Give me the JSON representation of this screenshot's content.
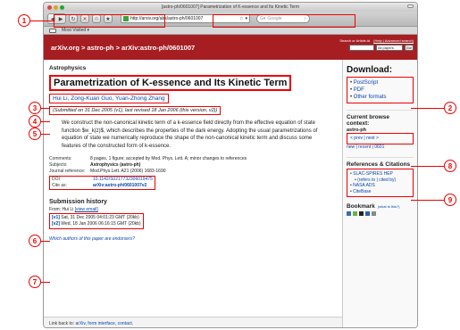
{
  "window": {
    "title": "[astro-ph/0601007] Parametrization of K-essence and Its Kinetic Term"
  },
  "toolbar": {
    "url": "http://arxiv.org/abs/astro-ph/0601007",
    "search_placeholder": "Google",
    "bookmark_label": "Most Visited ▾"
  },
  "header": {
    "breadcrumb": "arXiv.org > astro-ph > arXiv:astro-ph/0601007",
    "search_label": "Search or Article-id",
    "help_link": "(Help | Advanced search)",
    "search_scope": "All papers",
    "go_label": "Go!"
  },
  "paper": {
    "section": "Astrophysics",
    "title": "Parametrization of K-essence and Its Kinetic Term",
    "authors": "Hui Li, Zong-Kuan Guo, Yuan-Zhong Zhang",
    "submitted": "(Submitted on 31 Dec 2005 (v1), last revised 18 Jan 2006 (this version, v2))",
    "abstract": "We construct the non-canonical kinetic term of a k-essence field directly from the effective equation of state function $w_k(z)$, which describes the properties of the dark energy. Adopting the usual parametrizations of equation of state we numerically reproduce the shape of the non-canonical kinetic term and discuss some features of the constructed form of k-essence."
  },
  "meta": {
    "comments_key": "Comments:",
    "comments_val": "8 pages, 1 figure; accepted by Mod. Phys. Lett. A; minor changes to references",
    "subjects_key": "Subjects:",
    "subjects_val": "Astrophysics (astro-ph)",
    "journal_key": "Journal reference:",
    "journal_val": "Mod.Phys.Lett. A21 (2006) 1683-1690",
    "doi_key": "DOI",
    "doi_val": "10.1142/S0217732306019475",
    "cite_key": "Cite as:",
    "cite_val": "arXiv:astro-ph/0601007v2"
  },
  "history": {
    "title": "Submission history",
    "from_label": "From: Hui Li",
    "email_link": "[view email]",
    "v1_tag": "[v1]",
    "v1_text": "Sat, 31 Dec 2005 04:01:23 GMT (20kb)",
    "v2_tag": "[v2]",
    "v2_text": "Wed, 18 Jan 2006 06:16:15 GMT (20kb)",
    "endorsers": "Which authors of this paper are endorsers?"
  },
  "footer": {
    "prefix": "Link back to:",
    "links": "arXiv, form interface, contact."
  },
  "sidebar": {
    "download_title": "Download:",
    "downloads": [
      "PostScript",
      "PDF",
      "Other formats"
    ],
    "context_title": "Current browse context:",
    "context_cat": "astro-ph",
    "context_nav1": "< prev | next >",
    "context_nav2": "new | recent | 0601",
    "refs_title": "References & Citations",
    "refs": [
      "SLAC-SPIRES HEP",
      "NASA ADS",
      "CiteBase"
    ],
    "refs_sub": "(refers to | cited by)",
    "bookmark_title": "Bookmark",
    "bookmark_what": "(what is this?)"
  },
  "callouts": [
    "1",
    "2",
    "3",
    "4",
    "5",
    "6",
    "7",
    "8",
    "9"
  ],
  "colors": {
    "arxiv_red": "#a71e22",
    "highlight": "#e00000",
    "link_blue": "#0645ad"
  }
}
